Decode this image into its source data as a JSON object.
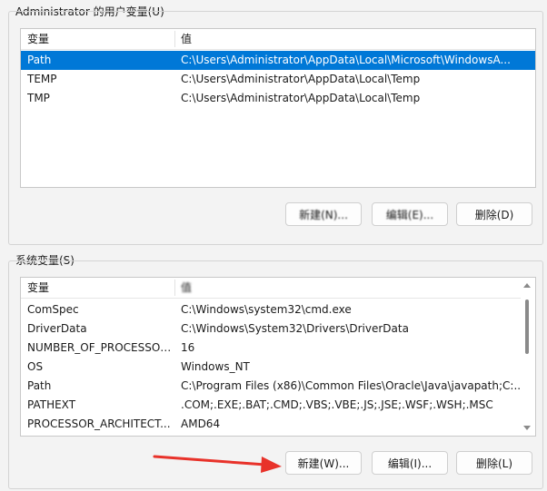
{
  "user_vars": {
    "title": "Administrator 的用户变量(U)",
    "col_variable": "变量",
    "col_value": "值",
    "rows": [
      {
        "name": "Path",
        "value": "C:\\Users\\Administrator\\AppData\\Local\\Microsoft\\WindowsA...",
        "selected": true
      },
      {
        "name": "TEMP",
        "value": "C:\\Users\\Administrator\\AppData\\Local\\Temp",
        "selected": false
      },
      {
        "name": "TMP",
        "value": "C:\\Users\\Administrator\\AppData\\Local\\Temp",
        "selected": false
      }
    ],
    "buttons": {
      "new": "新建(N)...",
      "edit": "编辑(E)...",
      "delete": "删除(D)"
    }
  },
  "system_vars": {
    "title": "系统变量(S)",
    "col_variable": "变量",
    "col_value": "值",
    "rows": [
      {
        "name": "ComSpec",
        "value": "C:\\Windows\\system32\\cmd.exe"
      },
      {
        "name": "DriverData",
        "value": "C:\\Windows\\System32\\Drivers\\DriverData"
      },
      {
        "name": "NUMBER_OF_PROCESSORS",
        "value": "16"
      },
      {
        "name": "OS",
        "value": "Windows_NT"
      },
      {
        "name": "Path",
        "value": "C:\\Program Files (x86)\\Common Files\\Oracle\\Java\\javapath;C:..."
      },
      {
        "name": "PATHEXT",
        "value": ".COM;.EXE;.BAT;.CMD;.VBS;.VBE;.JS;.JSE;.WSF;.WSH;.MSC"
      },
      {
        "name": "PROCESSOR_ARCHITECT...",
        "value": "AMD64"
      }
    ],
    "buttons": {
      "new": "新建(W)...",
      "edit": "编辑(I)...",
      "delete": "删除(L)"
    }
  },
  "colors": {
    "selection": "#0078d7",
    "arrow": "#e8322a"
  }
}
